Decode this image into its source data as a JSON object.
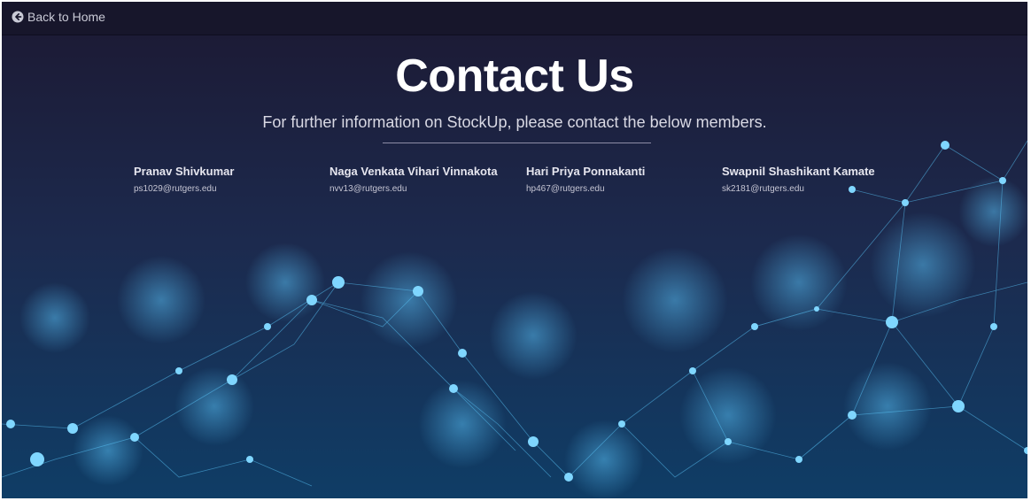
{
  "nav": {
    "back_label": "Back to Home",
    "back_icon": "arrow-circle-left-icon"
  },
  "header": {
    "title": "Contact Us",
    "subtitle": "For further information on StockUp, please contact the below members."
  },
  "members": [
    {
      "name": "Pranav Shivkumar",
      "email": "ps1029@rutgers.edu"
    },
    {
      "name": "Naga Venkata Vihari Vinnakota",
      "email": "nvv13@rutgers.edu"
    },
    {
      "name": "Hari Priya Ponnakanti",
      "email": "hp467@rutgers.edu"
    },
    {
      "name": "Swapnil Shashikant Kamate",
      "email": "sk2181@rutgers.edu"
    }
  ],
  "colors": {
    "background": "#1c1b36",
    "topbar": "#17162b",
    "network_accent": "#3fb8ff"
  }
}
